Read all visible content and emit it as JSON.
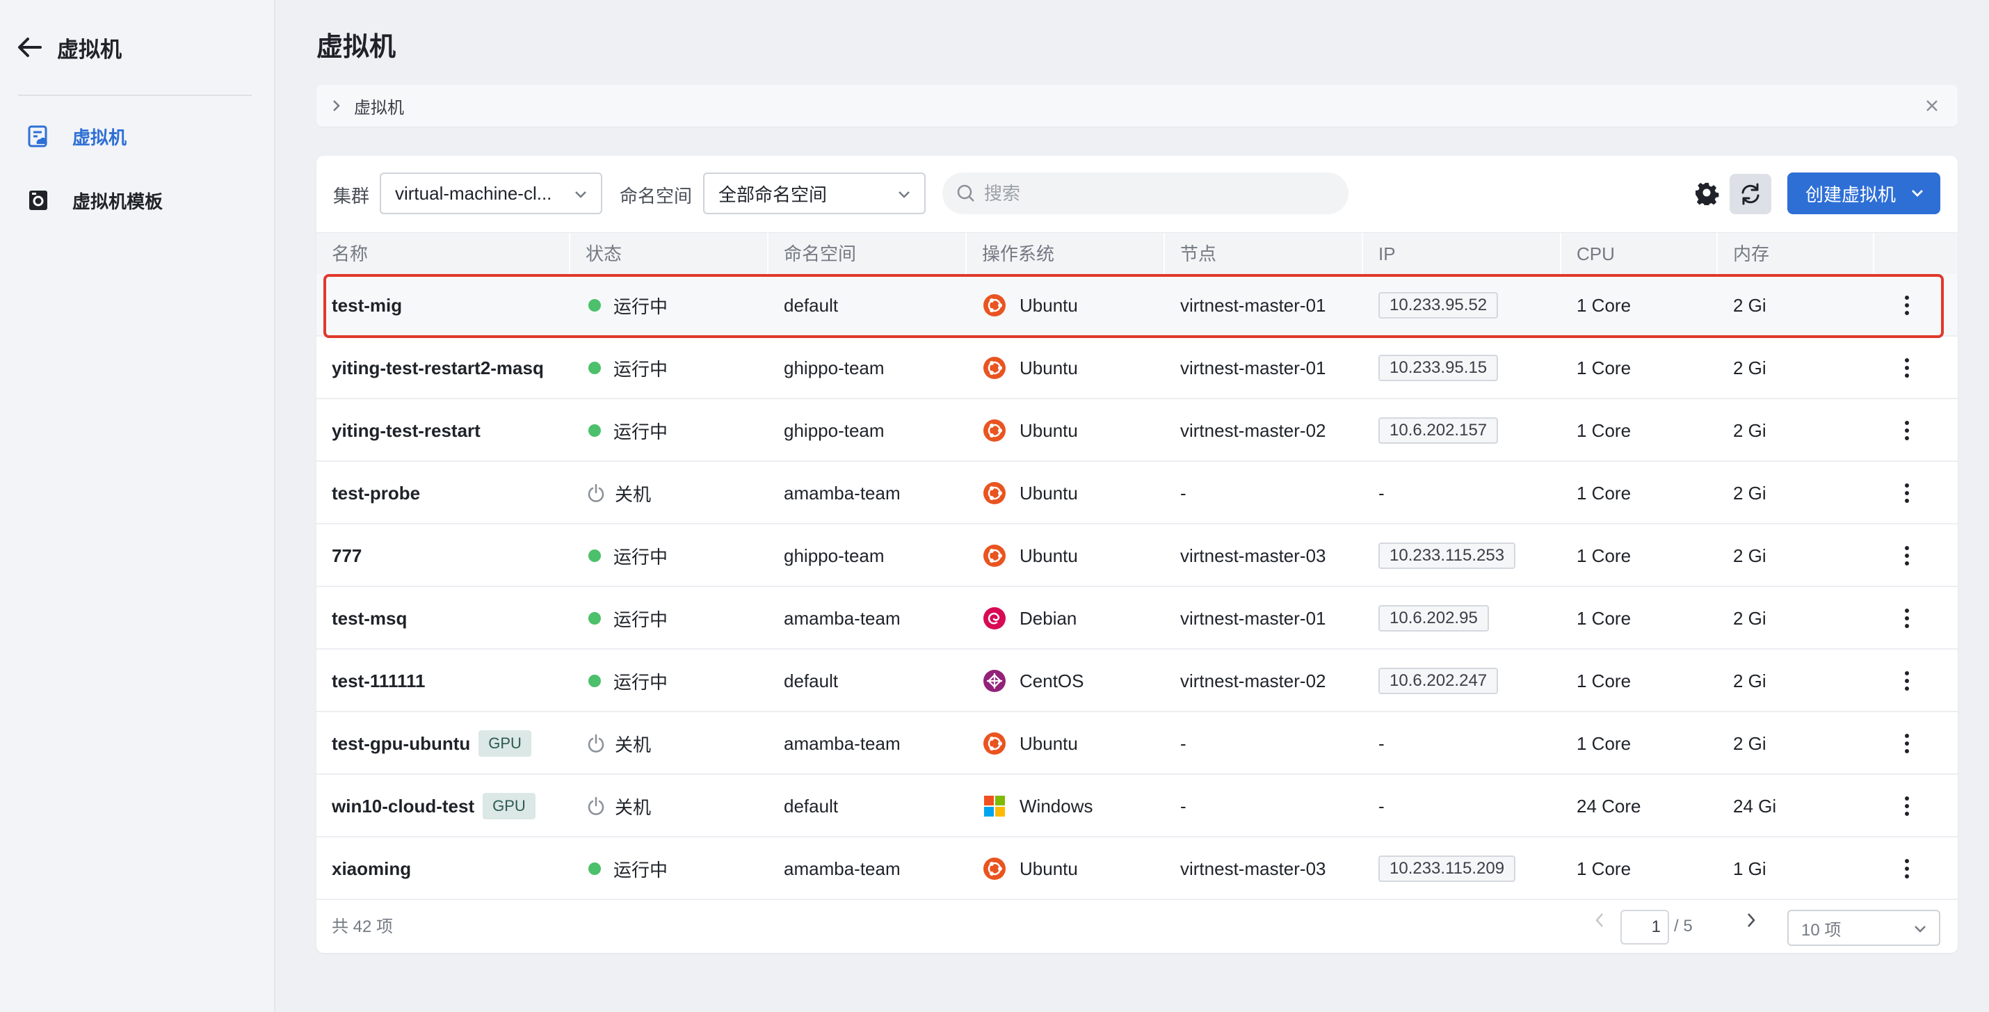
{
  "sidebar": {
    "title": "虚拟机",
    "items": [
      {
        "label": "虚拟机",
        "active": true
      },
      {
        "label": "虚拟机模板",
        "active": false
      }
    ]
  },
  "page_title": "虚拟机",
  "breadcrumb": {
    "label": "虚拟机"
  },
  "toolbar": {
    "cluster_label": "集群",
    "cluster_value": "virtual-machine-cl...",
    "namespace_label": "命名空间",
    "namespace_value": "全部命名空间",
    "search_placeholder": "搜索",
    "create_label": "创建虚拟机"
  },
  "table": {
    "headers": [
      "名称",
      "状态",
      "命名空间",
      "操作系统",
      "节点",
      "IP",
      "CPU",
      "内存"
    ],
    "rows": [
      {
        "name": "test-mig",
        "gpu": "",
        "status": "运行中",
        "running": true,
        "namespace": "default",
        "os": "Ubuntu",
        "os_icon": "ubuntu-icon",
        "node": "virtnest-master-01",
        "ip": "10.233.95.52",
        "cpu": "1 Core",
        "memory": "2 Gi"
      },
      {
        "name": "yiting-test-restart2-masq",
        "gpu": "",
        "status": "运行中",
        "running": true,
        "namespace": "ghippo-team",
        "os": "Ubuntu",
        "os_icon": "ubuntu-icon",
        "node": "virtnest-master-01",
        "ip": "10.233.95.15",
        "cpu": "1 Core",
        "memory": "2 Gi"
      },
      {
        "name": "yiting-test-restart",
        "gpu": "",
        "status": "运行中",
        "running": true,
        "namespace": "ghippo-team",
        "os": "Ubuntu",
        "os_icon": "ubuntu-icon",
        "node": "virtnest-master-02",
        "ip": "10.6.202.157",
        "cpu": "1 Core",
        "memory": "2 Gi"
      },
      {
        "name": "test-probe",
        "gpu": "",
        "status": "关机",
        "running": false,
        "namespace": "amamba-team",
        "os": "Ubuntu",
        "os_icon": "ubuntu-icon",
        "node": "-",
        "ip": "-",
        "cpu": "1 Core",
        "memory": "2 Gi"
      },
      {
        "name": "777",
        "gpu": "",
        "status": "运行中",
        "running": true,
        "namespace": "ghippo-team",
        "os": "Ubuntu",
        "os_icon": "ubuntu-icon",
        "node": "virtnest-master-03",
        "ip": "10.233.115.253",
        "cpu": "1 Core",
        "memory": "2 Gi"
      },
      {
        "name": "test-msq",
        "gpu": "",
        "status": "运行中",
        "running": true,
        "namespace": "amamba-team",
        "os": "Debian",
        "os_icon": "debian-icon",
        "node": "virtnest-master-01",
        "ip": "10.6.202.95",
        "cpu": "1 Core",
        "memory": "2 Gi"
      },
      {
        "name": "test-111111",
        "gpu": "",
        "status": "运行中",
        "running": true,
        "namespace": "default",
        "os": "CentOS",
        "os_icon": "centos-icon",
        "node": "virtnest-master-02",
        "ip": "10.6.202.247",
        "cpu": "1 Core",
        "memory": "2 Gi"
      },
      {
        "name": "test-gpu-ubuntu",
        "gpu": "GPU",
        "status": "关机",
        "running": false,
        "namespace": "amamba-team",
        "os": "Ubuntu",
        "os_icon": "ubuntu-icon",
        "node": "-",
        "ip": "-",
        "cpu": "1 Core",
        "memory": "2 Gi"
      },
      {
        "name": "win10-cloud-test",
        "gpu": "GPU",
        "status": "关机",
        "running": false,
        "namespace": "default",
        "os": "Windows",
        "os_icon": "windows-icon",
        "node": "-",
        "ip": "-",
        "cpu": "24 Core",
        "memory": "24 Gi"
      },
      {
        "name": "xiaoming",
        "gpu": "",
        "status": "运行中",
        "running": true,
        "namespace": "amamba-team",
        "os": "Ubuntu",
        "os_icon": "ubuntu-icon",
        "node": "virtnest-master-03",
        "ip": "10.233.115.209",
        "cpu": "1 Core",
        "memory": "1 Gi"
      }
    ]
  },
  "footer": {
    "total": "共 42 项",
    "page_current": "1",
    "page_total": "/ 5",
    "page_size": "10 项"
  },
  "colors": {
    "accent": "#2e6fd6",
    "running": "#4cc06a",
    "highlight": "#e0392b",
    "ubuntu": "#e95420"
  }
}
